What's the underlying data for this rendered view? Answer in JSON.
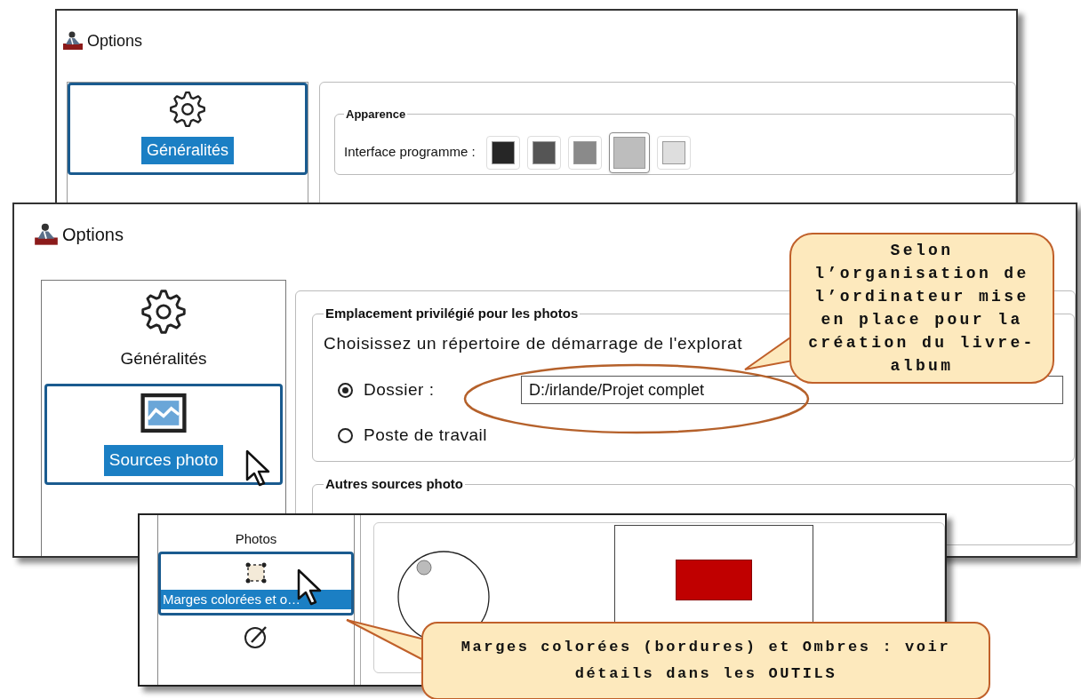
{
  "back_window": {
    "title": "Options",
    "nav_items": [
      {
        "label": "Généralités",
        "selected": true
      }
    ],
    "appearance": {
      "title": "Apparence",
      "label": "Interface programme :",
      "swatches": [
        {
          "color": "#262626",
          "selected": false
        },
        {
          "color": "#555555",
          "selected": false
        },
        {
          "color": "#8a8a8a",
          "selected": false
        },
        {
          "color": "#bdbdbd",
          "selected": true
        },
        {
          "color": "#dedede",
          "selected": false
        }
      ]
    }
  },
  "middle_window": {
    "title": "Options",
    "nav_items": [
      {
        "label": "Généralités",
        "selected": false
      },
      {
        "label": "Sources photo",
        "selected": true
      }
    ],
    "location_group": {
      "title": "Emplacement privilégié pour les photos",
      "description": "Choisissez un répertoire de démarrage de l'explorat",
      "options": [
        {
          "label": "Dossier :",
          "selected": true,
          "value": "D:/irlande/Projet complet"
        },
        {
          "label": "Poste de travail",
          "selected": false
        }
      ]
    },
    "other_group": {
      "title": "Autres sources photo"
    }
  },
  "front_window": {
    "nav_items": [
      {
        "kind": "heading",
        "label": "Photos"
      },
      {
        "kind": "item",
        "label": "Marges colorées et o…",
        "selected": true
      },
      {
        "kind": "item",
        "selected": false
      }
    ]
  },
  "callouts": [
    {
      "text": "Selon l’organisation de l’ordinateur mise en place pour la création du livre-album"
    },
    {
      "text": "Marges colorées (bordures) et Ombres : voir détails dans les OUTILS"
    }
  ]
}
